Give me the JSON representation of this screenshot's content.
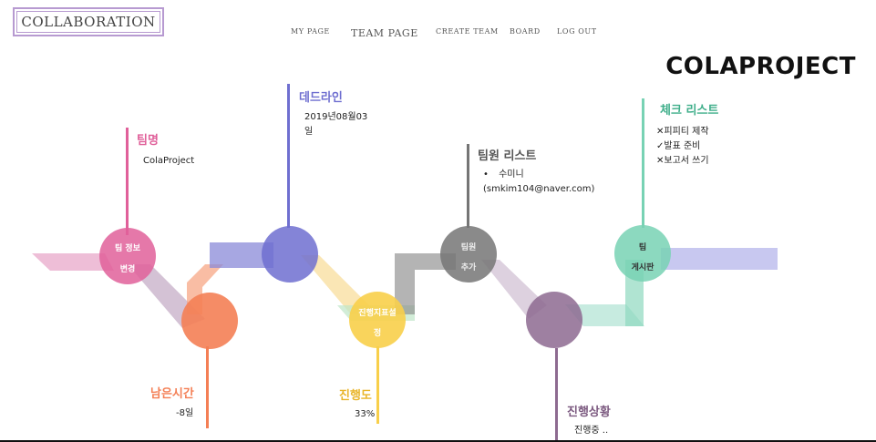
{
  "header": {
    "logo": "COLLABORATION",
    "nav": {
      "my_page": "MY PAGE",
      "team_page": "TEAM PAGE",
      "create_team": "CREATE TEAM",
      "board": "BOARD",
      "logout": "LOG OUT"
    }
  },
  "project_name": "COLAPROJECT",
  "team_name": {
    "title": "팀명",
    "value": "ColaProject"
  },
  "deadline": {
    "title": "데드라인",
    "value_line1": "2019년08월03",
    "value_line2": "일"
  },
  "members": {
    "title": "팀원 리스트",
    "bullet": "•",
    "name": "수미니",
    "email": "(smkim104@naver.com)"
  },
  "checklist": {
    "title": "체크 리스트",
    "items": [
      {
        "mark": "✕",
        "text": "피피티 제작"
      },
      {
        "mark": "✓",
        "text": "발표 준비"
      },
      {
        "mark": "✕",
        "text": "보고서 쓰기"
      }
    ]
  },
  "remaining": {
    "title": "남은시간",
    "value": "-8일"
  },
  "progress": {
    "title": "진행도",
    "value": "33%"
  },
  "status": {
    "title": "진행상황",
    "value": "진행중 .."
  },
  "nodes": {
    "team_info_line1": "팀 정보",
    "team_info_line2": "변경",
    "set_progress_line1": "진행지표설",
    "set_progress_line2": "정",
    "add_member_line1": "팀원",
    "add_member_line2": "추가",
    "board_line1": "팀",
    "board_line2": "게시판"
  },
  "colors": {
    "pink": "#e0609a",
    "orange": "#f47f55",
    "blue": "#6f6fd0",
    "yellow": "#f8cf4a",
    "gray": "#757575",
    "purple": "#8d6a90",
    "teal": "#78d2b4",
    "lavender": "#c2c2ee"
  }
}
